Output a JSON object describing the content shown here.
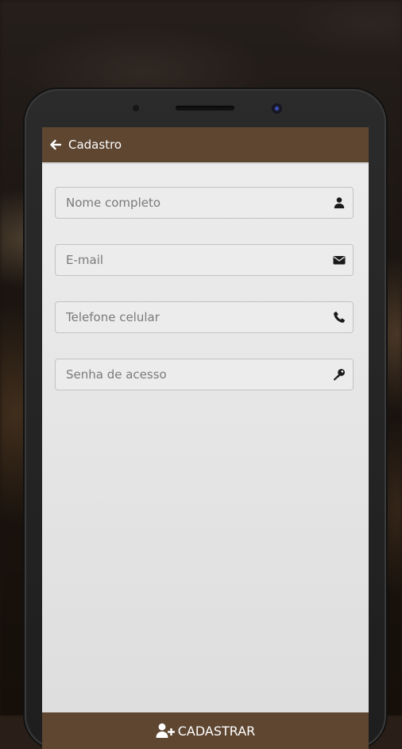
{
  "appbar": {
    "title": "Cadastro",
    "back_icon": "arrow-left-icon"
  },
  "form": {
    "fields": [
      {
        "placeholder": "Nome completo",
        "value": "",
        "icon": "user-icon"
      },
      {
        "placeholder": "E-mail",
        "value": "",
        "icon": "envelope-icon"
      },
      {
        "placeholder": "Telefone celular",
        "value": "",
        "icon": "phone-icon"
      },
      {
        "placeholder": "Senha de acesso",
        "value": "",
        "icon": "key-icon"
      }
    ]
  },
  "submit": {
    "label": "CADASTRAR",
    "icon": "user-plus-icon"
  },
  "colors": {
    "primary": "#5e4631",
    "screen_bg": "#e6e6e6",
    "field_bg": "#ececec",
    "field_border": "#c2c2c2",
    "placeholder": "#7a7a7a"
  }
}
